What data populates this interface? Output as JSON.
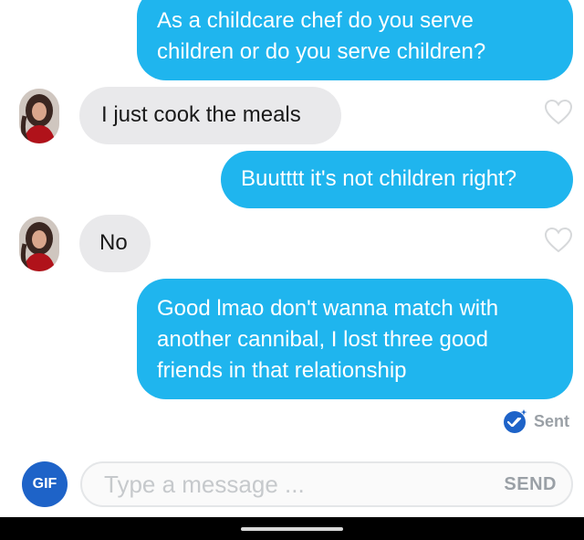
{
  "conversation": {
    "messages": [
      {
        "direction": "outgoing",
        "text": "As a childcare chef do you serve children or do you serve children?"
      },
      {
        "direction": "incoming",
        "text": "I just cook the meals"
      },
      {
        "direction": "outgoing",
        "text": "Buutttt it's not children right?"
      },
      {
        "direction": "incoming",
        "text": "No"
      },
      {
        "direction": "outgoing",
        "text": "Good lmao don't wanna match with another cannibal, I lost three good friends in that relationship"
      }
    ],
    "status": {
      "label": "Sent",
      "icon": "double-check-icon"
    }
  },
  "composer": {
    "gif_label": "GIF",
    "placeholder": "Type a message ...",
    "send_label": "SEND"
  },
  "colors": {
    "outgoing_bubble": "#1fb5ee",
    "incoming_bubble": "#e9e9eb",
    "gif_button": "#1e63c8",
    "sent_icon": "#1e63c8"
  }
}
